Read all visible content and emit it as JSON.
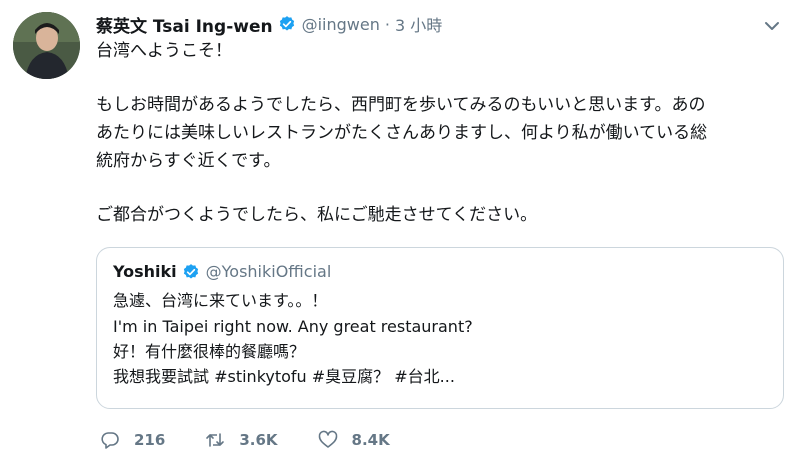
{
  "tweet": {
    "author_name": "蔡英文 Tsai Ing-wen",
    "author_handle": "@iingwen",
    "separator": "·",
    "timestamp": "3 小時",
    "lines": [
      "台湾へようこそ！",
      "もしお時間があるようでしたら、西門町を歩いてみるのもいいと思います。あの",
      "あたりには美味しいレストランがたくさんありますし、何より私が働いている総",
      "統府からすぐ近くです。",
      "ご都合がつくようでしたら、私にご馳走させてください。"
    ]
  },
  "quoted_tweet": {
    "author_name": "Yoshiki",
    "author_handle": "@YoshikiOfficial",
    "lines": [
      "急遽、台湾に来ています。。！",
      "I'm in Taipei right now. Any great restaurant?",
      "好！有什麼很棒的餐廳嗎？",
      "我想我要試試 #stinkytofu #臭豆腐？ #台北..."
    ]
  },
  "actions": {
    "replies": "216",
    "retweets": "3.6K",
    "likes": "8.4K"
  },
  "colors": {
    "text": "#14171a",
    "secondary": "#657786",
    "verified": "#1da1f2",
    "border": "#ccd6dd"
  },
  "icons": {
    "verified": "verified-badge-icon",
    "caret": "chevron-down-icon",
    "reply": "reply-icon",
    "retweet": "retweet-icon",
    "like": "heart-icon"
  }
}
